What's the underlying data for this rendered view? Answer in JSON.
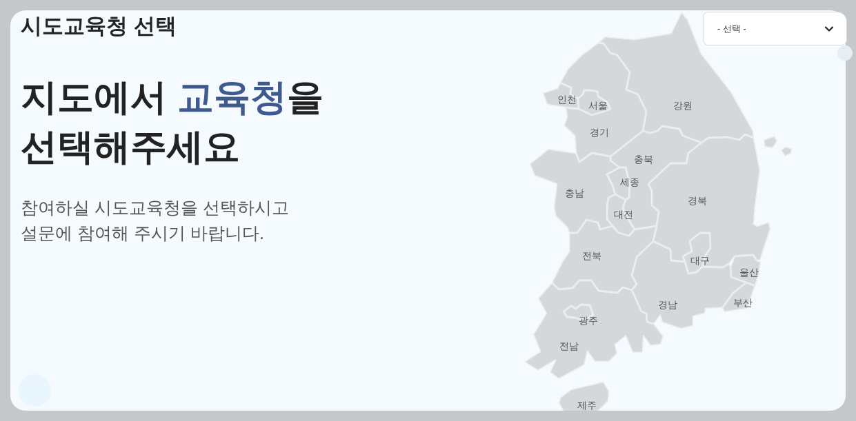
{
  "page_title": "시도교육청 선택",
  "headline": [
    {
      "text": "지도에서 ",
      "highlight": false
    },
    {
      "text": "교육청",
      "highlight": true
    },
    {
      "text": "을\n선택해주세요",
      "highlight": false
    }
  ],
  "description": "참여하실 시도교육청을 선택하시고\n설문에 참여해 주시기 바랍니다.",
  "region_select": {
    "value": "- 선택 -"
  },
  "map": {
    "regions": [
      {
        "label": "인천"
      },
      {
        "label": "서울"
      },
      {
        "label": "강원"
      },
      {
        "label": "경기"
      },
      {
        "label": "충북"
      },
      {
        "label": "세종"
      },
      {
        "label": "충남"
      },
      {
        "label": "경북"
      },
      {
        "label": "대전"
      },
      {
        "label": "대구"
      },
      {
        "label": "전북"
      },
      {
        "label": "울산"
      },
      {
        "label": "부산"
      },
      {
        "label": "경남"
      },
      {
        "label": "광주"
      },
      {
        "label": "전남"
      },
      {
        "label": "제주"
      }
    ]
  }
}
